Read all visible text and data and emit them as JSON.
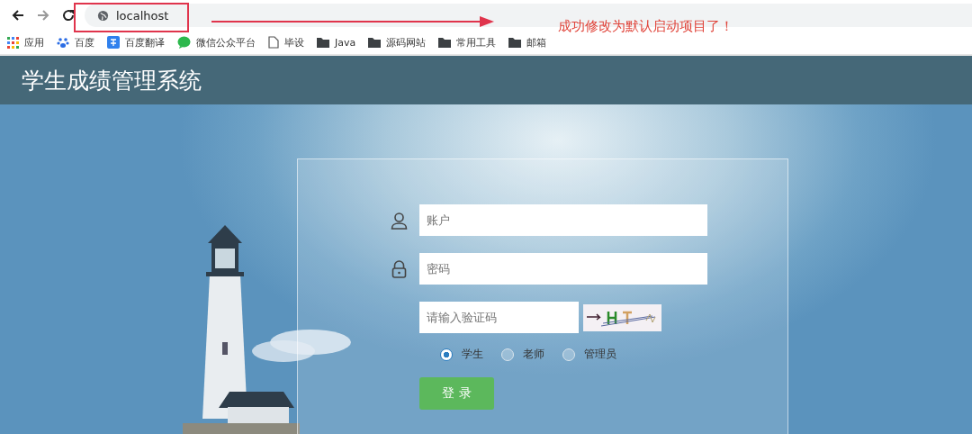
{
  "browser": {
    "nav": [
      {
        "kind": "back",
        "disabled": false
      },
      {
        "kind": "forward",
        "disabled": true
      },
      {
        "kind": "reload",
        "disabled": false
      }
    ],
    "address": "localhost",
    "bookmarks": [
      {
        "label": "应用",
        "kind": "apps"
      },
      {
        "label": "百度",
        "kind": "paw"
      },
      {
        "label": "百度翻译",
        "kind": "translate"
      },
      {
        "label": "微信公众平台",
        "kind": "chat"
      },
      {
        "label": "毕设",
        "kind": "page"
      },
      {
        "label": "Java",
        "kind": "folder"
      },
      {
        "label": "源码网站",
        "kind": "folder"
      },
      {
        "label": "常用工具",
        "kind": "folder"
      },
      {
        "label": "邮箱",
        "kind": "folder"
      }
    ]
  },
  "annotation": {
    "text": "成功修改为默认启动项目了！"
  },
  "header": {
    "title": "学生成绩管理系统"
  },
  "login": {
    "fields": [
      {
        "kind": "user",
        "placeholder": "账户"
      },
      {
        "kind": "password",
        "placeholder": "密码"
      }
    ],
    "captcha": {
      "placeholder": "请输入验证码"
    },
    "roles": [
      {
        "label": "学生",
        "selected": true
      },
      {
        "label": "老师",
        "selected": false
      },
      {
        "label": "管理员",
        "selected": false
      }
    ],
    "submit": "登 录"
  }
}
